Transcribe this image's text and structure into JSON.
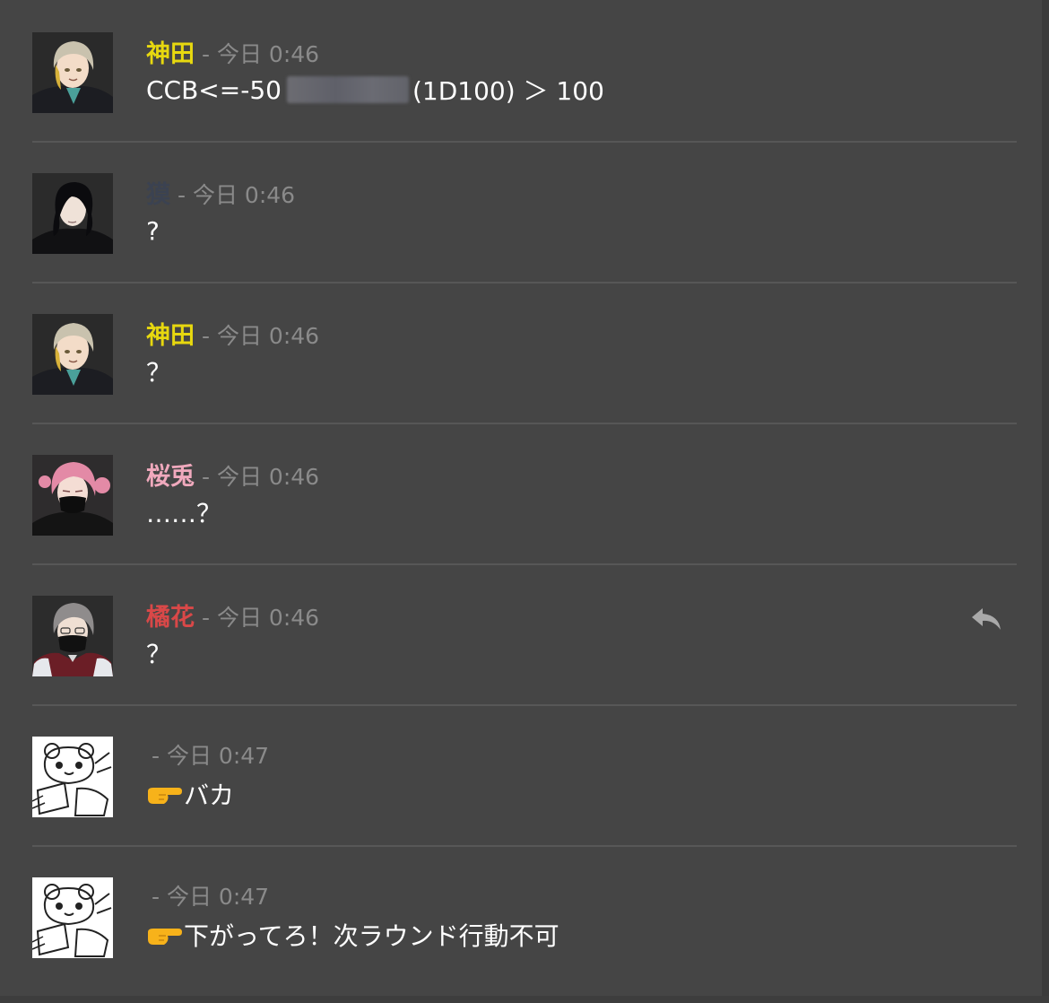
{
  "messages": [
    {
      "speaker": "神田",
      "speaker_color": "#e7d80f",
      "time": "- 今日 0:46",
      "avatar": "gray-haired-man-avatar",
      "text_before": "CCB<=-50",
      "text_after": "(1D100) ＞ 100",
      "redacted": true
    },
    {
      "speaker": "獏",
      "speaker_color": "#3b4251",
      "time": "- 今日 0:46",
      "avatar": "black-haired-man-avatar",
      "text": "?"
    },
    {
      "speaker": "神田",
      "speaker_color": "#e7d80f",
      "time": "- 今日 0:46",
      "avatar": "gray-haired-man-avatar",
      "text": "？"
    },
    {
      "speaker": "桜兎",
      "speaker_color": "#f0a9bd",
      "time": "- 今日 0:46",
      "avatar": "pink-haired-man-avatar",
      "text": "……？"
    },
    {
      "speaker": "橘花",
      "speaker_color": "#d94848",
      "time": "- 今日 0:46",
      "avatar": "masked-man-avatar",
      "text": "？",
      "action_icon": "reply-icon"
    },
    {
      "speaker": "",
      "time": "- 今日 0:47",
      "avatar": "bear-sketch-avatar",
      "emoji": "pointing-right-emoji",
      "text": "バカ"
    },
    {
      "speaker": "",
      "time": "- 今日 0:47",
      "avatar": "bear-sketch-avatar",
      "emoji": "pointing-right-emoji",
      "text": "下がってろ！次ラウンド行動不可"
    }
  ],
  "colors": {
    "background": "#454545",
    "divider": "#575757",
    "timestamp": "#8a8a8a",
    "text": "#ffffff"
  }
}
